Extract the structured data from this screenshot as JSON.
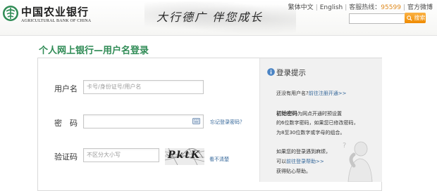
{
  "brand": {
    "name_cn": "中国农业银行",
    "name_en": "AGRICULTURAL BANK OF CHINA",
    "slogan": "大行德广  伴您成长"
  },
  "toplinks": {
    "traditional": "繁体中文",
    "english": "English",
    "hotline_label": "客服热线：",
    "hotline_number": "95599",
    "weibo": "官方微博"
  },
  "search": {
    "placeholder": "",
    "button_label": "搜索"
  },
  "page_title": "个人网上银行—用户名登录",
  "form": {
    "username_label": "用户名",
    "username_placeholder": "卡号/身份证号/用户名",
    "password_label": "密　码",
    "password_placeholder": "",
    "forgot_password": "忘记登录密码？",
    "captcha_label": "验证码",
    "captcha_placeholder": "不区分大小写",
    "captcha_text": "PktK",
    "captcha_refresh": "看不清楚"
  },
  "tips": {
    "title": "登录提示",
    "line1_text": "还没有用户名?",
    "line1_link": "前往注册开通>>",
    "initial_pwd_label": "初始密码",
    "initial_pwd_line1": "为网点开通时预设置",
    "initial_pwd_line2": "的6位数字密码，如果您已修改密码，",
    "initial_pwd_line3": "为8至30位数字或字母的组合。",
    "trouble_line1": "如果您的登录遇到麻烦，",
    "trouble_line2_text": "可以",
    "trouble_line2_link": "前往登录帮助>>",
    "trouble_line3": "获得贴心帮助。"
  },
  "colors": {
    "accent_green": "#2f8b55",
    "search_orange": "#ef8a00",
    "hotline_orange": "#e08a1e",
    "link_blue": "#336699",
    "tips_bg": "#f1f1f1"
  },
  "icons": [
    "abc-logo-icon",
    "search-icon",
    "keyboard-icon",
    "info-icon"
  ]
}
